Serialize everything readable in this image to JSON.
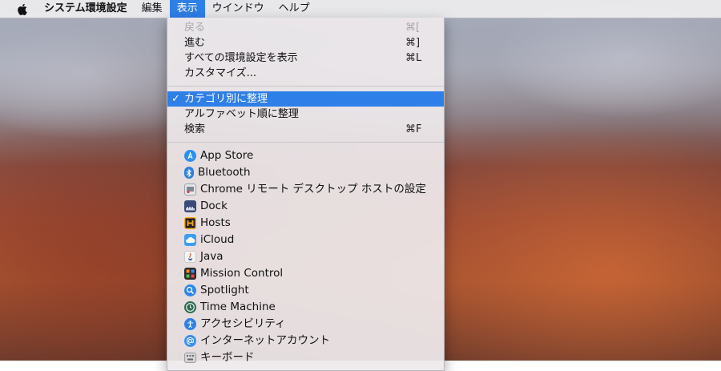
{
  "menubar": {
    "app_name": "システム環境設定",
    "items": [
      "編集",
      "表示",
      "ウインドウ",
      "ヘルプ"
    ],
    "active_index": 1
  },
  "view_menu": {
    "group1": [
      {
        "label": "戻る",
        "shortcut": "⌘[",
        "enabled": false
      },
      {
        "label": "進む",
        "shortcut": "⌘]",
        "enabled": true
      },
      {
        "label": "すべての環境設定を表示",
        "shortcut": "⌘L",
        "enabled": true
      },
      {
        "label": "カスタマイズ...",
        "shortcut": "",
        "enabled": true
      }
    ],
    "group2": [
      {
        "label": "カテゴリ別に整理",
        "shortcut": "",
        "checked": true,
        "selected": true
      },
      {
        "label": "アルファベット順に整理",
        "shortcut": "",
        "checked": false
      },
      {
        "label": "検索",
        "shortcut": "⌘F",
        "checked": false
      }
    ],
    "check_mark": "✓",
    "panes": [
      {
        "label": "App Store",
        "icon": "app-store-icon",
        "color": "#2b8ff0"
      },
      {
        "label": "Bluetooth",
        "icon": "bluetooth-icon",
        "color": "#2f7fe0"
      },
      {
        "label": "Chrome リモート デスクトップ ホストの設定",
        "icon": "chrome-remote-desktop-icon",
        "color": "#9aa0a8"
      },
      {
        "label": "Dock",
        "icon": "dock-icon",
        "color": "#3a4a7a"
      },
      {
        "label": "Hosts",
        "icon": "hosts-icon",
        "color": "#f2a21c"
      },
      {
        "label": "iCloud",
        "icon": "icloud-icon",
        "color": "#3d9df2"
      },
      {
        "label": "Java",
        "icon": "java-icon",
        "color": "#d84a2a"
      },
      {
        "label": "Mission Control",
        "icon": "mission-control-icon",
        "color": "#2a2a2a"
      },
      {
        "label": "Spotlight",
        "icon": "spotlight-icon",
        "color": "#2f86ea"
      },
      {
        "label": "Time Machine",
        "icon": "time-machine-icon",
        "color": "#2c6a4f"
      },
      {
        "label": "アクセシビリティ",
        "icon": "accessibility-icon",
        "color": "#2f7fe8"
      },
      {
        "label": "インターネットアカウント",
        "icon": "internet-accounts-icon",
        "color": "#3a8ef0"
      },
      {
        "label": "キーボード",
        "icon": "keyboard-icon",
        "color": "#c8c8cc"
      }
    ]
  }
}
